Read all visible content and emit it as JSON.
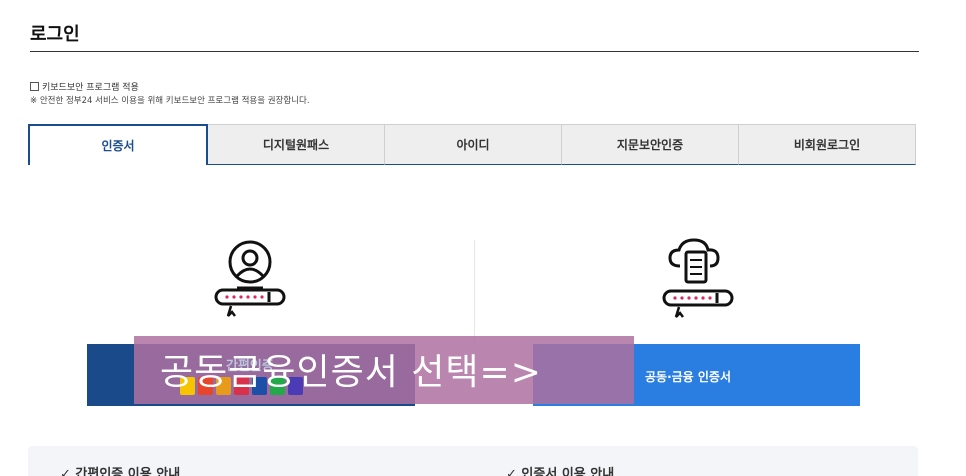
{
  "page": {
    "title": "로그인"
  },
  "keyboard": {
    "checkbox_label": "키보드보안 프로그램 적용",
    "notice": "※ 안전한 정부24 서비스 이용을 위해 키보드보안 프로그램 적용을 권장합니다."
  },
  "tabs": [
    {
      "label": "인증서",
      "active": true
    },
    {
      "label": "디지털원패스",
      "active": false
    },
    {
      "label": "아이디",
      "active": false
    },
    {
      "label": "지문보안인증",
      "active": false
    },
    {
      "label": "비회원로그인",
      "active": false
    }
  ],
  "options": {
    "simple": {
      "label": "간편인증",
      "icon": "user-password-icon",
      "providers": [
        "kakao",
        "PASS",
        "naver",
        "toss",
        "samsung",
        "NH",
        "shinhan"
      ]
    },
    "joint": {
      "label": "공동·금융 인증서",
      "icon": "cloud-server-password-icon"
    }
  },
  "overlay": {
    "text": "공동금융인증서 선택=>"
  },
  "info": {
    "simple_title": "간편인증 이용 안내",
    "cert_title": "인증서 이용 안내"
  },
  "colors": {
    "accent": "#1a4d8f",
    "simple_button": "#1b4a8a",
    "joint_button": "#2a7de1",
    "overlay": "#ae70a0"
  }
}
